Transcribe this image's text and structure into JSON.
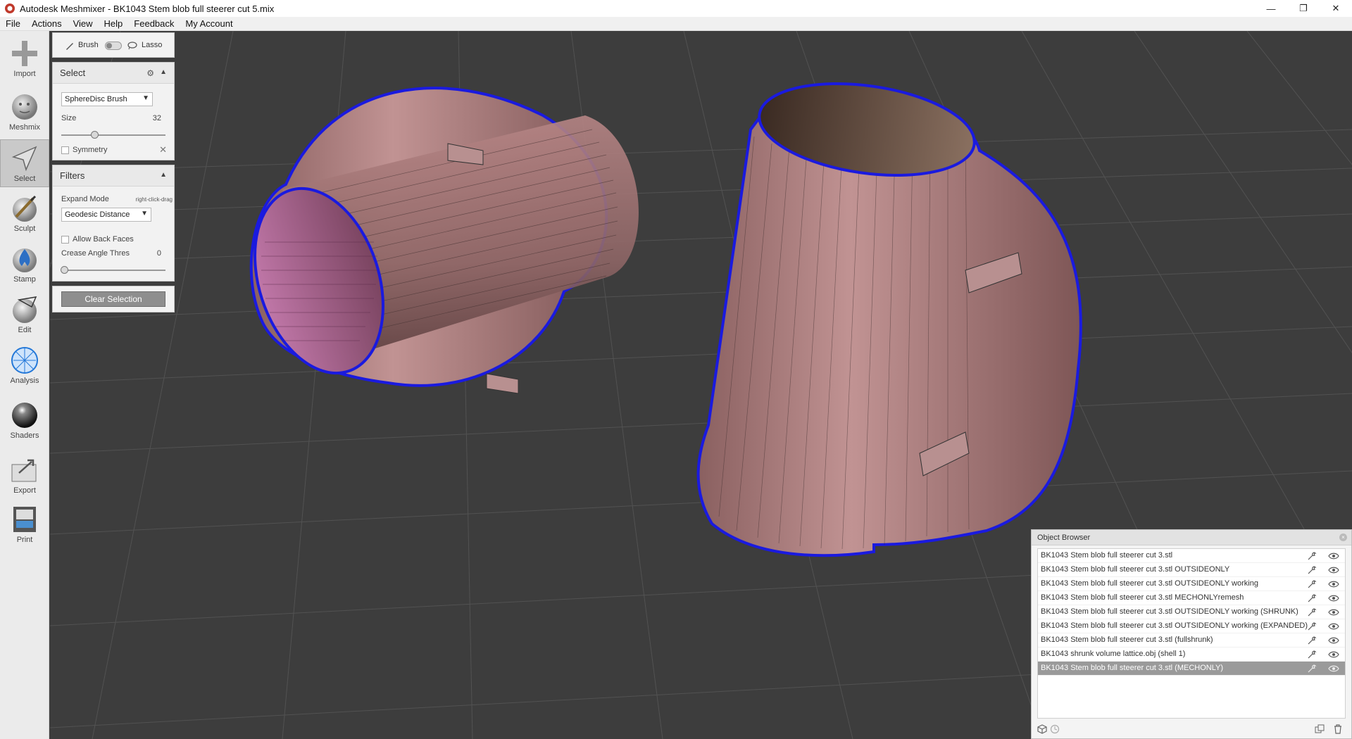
{
  "window": {
    "title": "Autodesk Meshmixer - BK1043 Stem blob full steerer cut 5.mix",
    "minimize": "—",
    "maximize": "❐",
    "close": "✕"
  },
  "menu": [
    "File",
    "Actions",
    "View",
    "Help",
    "Feedback",
    "My Account"
  ],
  "toolbar": [
    {
      "label": "Import",
      "icon": "import-icon"
    },
    {
      "label": "Meshmix",
      "icon": "meshmix-icon"
    },
    {
      "label": "Select",
      "icon": "select-icon",
      "active": true
    },
    {
      "label": "Sculpt",
      "icon": "sculpt-icon"
    },
    {
      "label": "Stamp",
      "icon": "stamp-icon"
    },
    {
      "label": "Edit",
      "icon": "edit-icon"
    },
    {
      "label": "Analysis",
      "icon": "analysis-icon"
    },
    {
      "label": "Shaders",
      "icon": "shaders-icon"
    },
    {
      "label": "Export",
      "icon": "export-icon"
    },
    {
      "label": "Print",
      "icon": "print-icon"
    }
  ],
  "mode_toggle": {
    "brush": "Brush",
    "lasso": "Lasso"
  },
  "select_panel": {
    "title": "Select",
    "brush_value": "SphereDisc Brush",
    "size_label": "Size",
    "size_value": "32",
    "size_fraction": 0.32,
    "symmetry_label": "Symmetry"
  },
  "filters_panel": {
    "title": "Filters",
    "expand_label": "Expand Mode",
    "expand_hint": "right-click-drag",
    "expand_value": "Geodesic Distance",
    "backfaces_label": "Allow Back Faces",
    "crease_label": "Crease Angle Thres",
    "crease_value": "0",
    "crease_fraction": 0.0
  },
  "clear_selection": "Clear Selection",
  "object_browser": {
    "title": "Object Browser",
    "items": [
      "BK1043 Stem blob full steerer cut 3.stl",
      "BK1043 Stem blob full steerer cut 3.stl OUTSIDEONLY",
      "BK1043 Stem blob full steerer cut 3.stl OUTSIDEONLY working",
      "BK1043 Stem blob full steerer cut 3.stl MECHONLYremesh",
      "BK1043 Stem blob full steerer cut 3.stl OUTSIDEONLY working (SHRUNK)",
      "BK1043 Stem blob full steerer cut 3.stl OUTSIDEONLY working (EXPANDED)",
      "BK1043 Stem blob full steerer cut 3.stl (fullshrunk)",
      "BK1043 shrunk volume lattice.obj (shell 1)",
      "BK1043 Stem blob full steerer cut 3.stl (MECHONLY)"
    ],
    "selected_index": 8
  },
  "colors": {
    "viewport_bg": "#3d3d3d",
    "grid": "#555555",
    "mesh": "#b48585",
    "selection_outline": "#1a1adf"
  }
}
